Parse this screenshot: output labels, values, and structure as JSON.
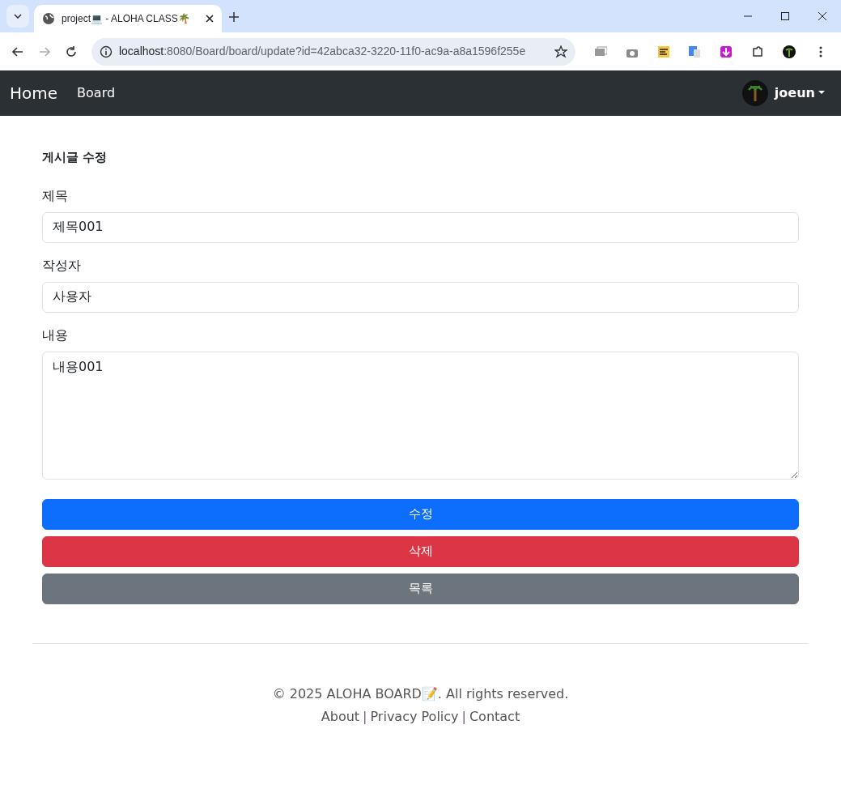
{
  "browser": {
    "tab_title": "project💻 - ALOHA CLASS🌴",
    "url_host": "localhost",
    "url_rest": ":8080/Board/board/update?id=42abca32-3220-11f0-ac9a-a8a1596f255e"
  },
  "navbar": {
    "brand": "Home",
    "links": [
      {
        "label": "Board"
      }
    ],
    "user": "joeun"
  },
  "form": {
    "heading": "게시글 수정",
    "fields": [
      {
        "label": "제목",
        "kind": "input",
        "value": "제목001"
      },
      {
        "label": "작성자",
        "kind": "input",
        "value": "사용자"
      },
      {
        "label": "내용",
        "kind": "textarea",
        "value": "내용001"
      }
    ],
    "buttons": [
      {
        "label": "수정",
        "kind": "primary"
      },
      {
        "label": "삭제",
        "kind": "danger"
      },
      {
        "label": "목록",
        "kind": "secondary"
      }
    ]
  },
  "footer": {
    "copyright": "© 2025 ALOHA BOARD📝. All rights reserved.",
    "links": [
      {
        "kind": "link",
        "label": "About"
      },
      {
        "kind": "separator",
        "label": "|"
      },
      {
        "kind": "link",
        "label": "Privacy Policy"
      },
      {
        "kind": "separator",
        "label": "|"
      },
      {
        "kind": "link",
        "label": "Contact"
      }
    ]
  }
}
